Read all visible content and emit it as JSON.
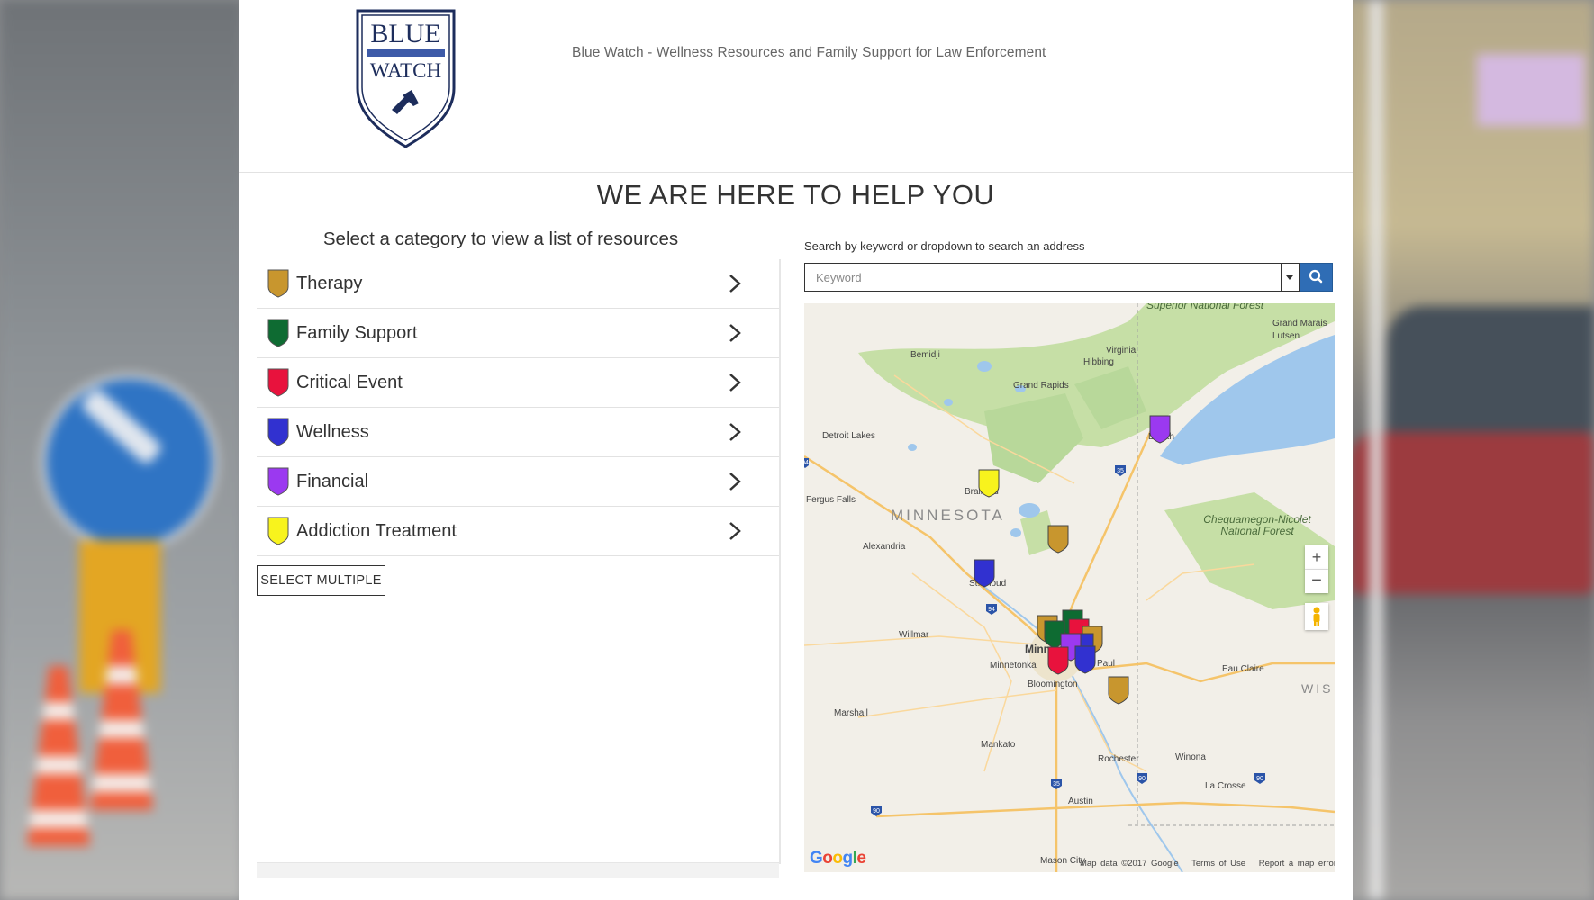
{
  "header": {
    "logo_line1": "BLUE",
    "logo_line2": "WATCH",
    "tagline": "Blue Watch - Wellness Resources and Family Support for Law Enforcement"
  },
  "page_title": "WE ARE HERE TO HELP YOU",
  "categories": {
    "heading": "Select a category to view a list of resources",
    "items": [
      {
        "label": "Therapy",
        "color": "#c8962e"
      },
      {
        "label": "Family Support",
        "color": "#0e6b32"
      },
      {
        "label": "Critical Event",
        "color": "#e8123d"
      },
      {
        "label": "Wellness",
        "color": "#3131d0"
      },
      {
        "label": "Financial",
        "color": "#9b39f0"
      },
      {
        "label": "Addiction Treatment",
        "color": "#f8f31d"
      }
    ],
    "select_multiple": "SELECT MULTIPLE"
  },
  "search": {
    "label": "Search by keyword or dropdown to search an address",
    "placeholder": "Keyword",
    "button_icon": "search-icon",
    "accent": "#2f6db5"
  },
  "map": {
    "labels": [
      "Superior National Forest",
      "Grand Marais",
      "Lutsen",
      "Bemidji",
      "Virginia",
      "Hibbing",
      "Grand Rapids",
      "Detroit Lakes",
      "Duluth",
      "Fergus Falls",
      "Brainerd",
      "MINNESOTA",
      "Chequamegon-Nicolet National Forest",
      "Alexandria",
      "St. Cloud",
      "Willmar",
      "Minneapolis",
      "Minnetonka",
      "St. Paul",
      "Eau Claire",
      "Bloomington",
      "WIS",
      "Marshall",
      "Mankato",
      "Rochester",
      "Winona",
      "La Crosse",
      "Austin",
      "Mason City"
    ],
    "highway_shields": [
      "94",
      "35",
      "94",
      "35",
      "90",
      "90",
      "90"
    ],
    "zoom_in": "+",
    "zoom_out": "−",
    "google": "Google",
    "footer_data": "Map data ©2017 Google",
    "footer_terms": "Terms of Use",
    "footer_report": "Report a map error",
    "marker_colors": {
      "therapy": "#c8962e",
      "family": "#0e6b32",
      "critical": "#e8123d",
      "wellness": "#3131d0",
      "financial": "#9b39f0",
      "addiction": "#f8f31d"
    }
  }
}
